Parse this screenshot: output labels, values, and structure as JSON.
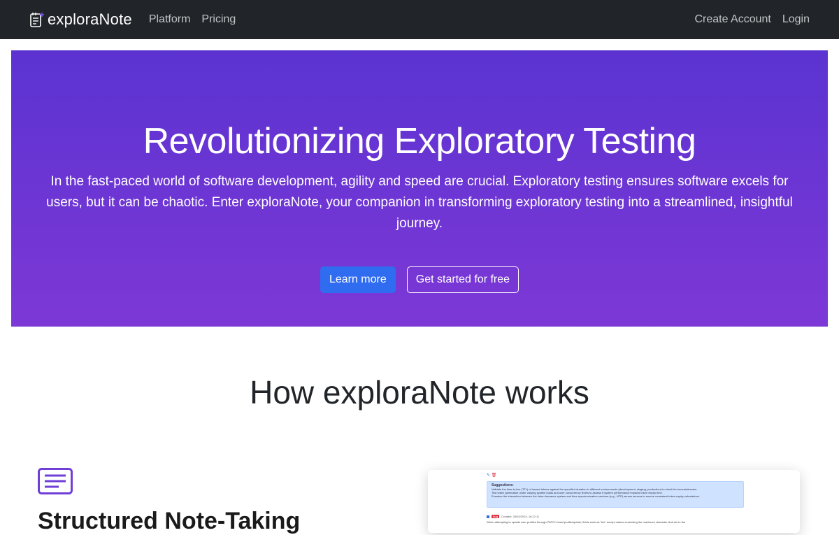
{
  "navbar": {
    "brand": "exploraNote",
    "links": [
      "Platform",
      "Pricing"
    ],
    "right_links": [
      "Create Account",
      "Login"
    ]
  },
  "hero": {
    "title": "Revolutionizing Exploratory Testing",
    "text": "In the fast-paced world of software development, agility and speed are crucial. Exploratory testing ensures software excels for users, but it can be chaotic. Enter exploraNote, your companion in transforming exploratory testing into a streamlined, insightful journey.",
    "primary_button": "Learn more",
    "secondary_button": "Get started for free"
  },
  "how_it_works": {
    "title_prefix": "How ",
    "title_brand": "exploraNote",
    "title_suffix": " works"
  },
  "feature": {
    "icon": "notes-icon",
    "title": "Structured Note-Taking"
  },
  "preview": {
    "suggestions_label": "Suggestions:",
    "suggestions": [
      "Validate the time-to-live (TTL) of issued tokens against the specified duration in different environments (development, staging, production) to check for inconsistencies.",
      "Test token generation under varying system loads and user concurrency levels to assess if system performance impacts token expiry time.",
      "Examine the interaction between the token issuance system and time synchronization services (e.g., NTP) across servers to ensure consistent token expiry calculations."
    ],
    "badge": "Bug",
    "created": "Created: 25/03/2024, 16:22:11",
    "note": "When attempting to update user profiles through PATCH /user/profile/update, fields such as \"bio\" accept values exceeding the maximum character limit set in the"
  },
  "colors": {
    "navbar": "#212529",
    "hero_gradient_start": "#5b33d1",
    "hero_gradient_end": "#7d38d6",
    "primary": "#2f6cf0",
    "feature_icon": "#6f3fd8"
  }
}
